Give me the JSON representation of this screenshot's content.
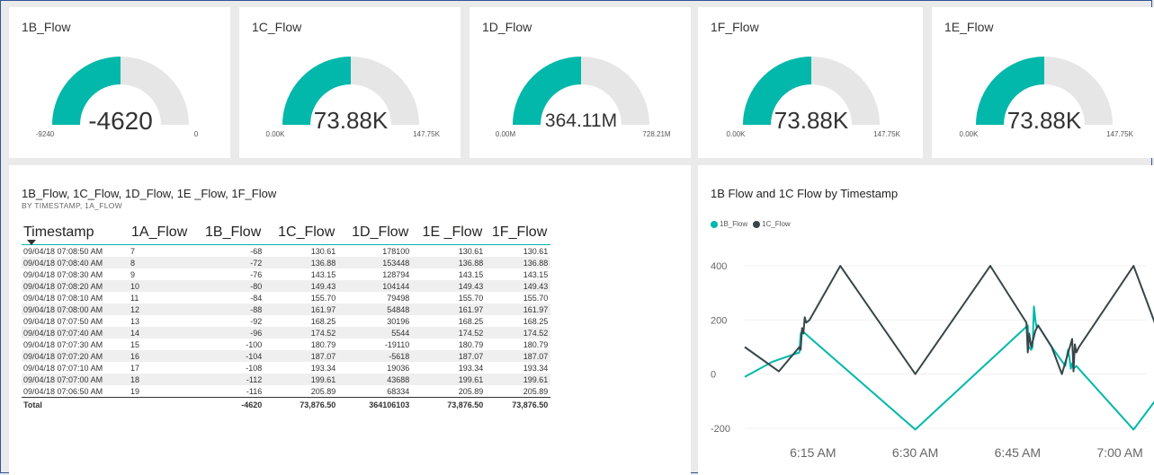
{
  "colors": {
    "accent": "#01b8aa",
    "dark": "#374649",
    "gauge_bg": "#e6e6e6"
  },
  "gauges": [
    {
      "title": "1B_Flow",
      "value": "-4620",
      "min": "-9240",
      "max": "0",
      "fraction": 0.5
    },
    {
      "title": "1C_Flow",
      "value": "73.88K",
      "min": "0.00K",
      "max": "147.75K",
      "fraction": 0.5
    },
    {
      "title": "1D_Flow",
      "value": "364.11M",
      "min": "0.00M",
      "max": "728.21M",
      "fraction": 0.5
    },
    {
      "title": "1F_Flow",
      "value": "73.88K",
      "min": "0.00K",
      "max": "147.75K",
      "fraction": 0.5
    },
    {
      "title": "1E_Flow",
      "value": "73.88K",
      "min": "0.00K",
      "max": "147.75K",
      "fraction": 0.5
    }
  ],
  "table": {
    "title": "1B_Flow, 1C_Flow, 1D_Flow, 1E _Flow, 1F_Flow",
    "subtitle": "BY TIMESTAMP, 1A_FLOW",
    "columns": [
      "Timestamp",
      "1A_Flow",
      "1B_Flow",
      "1C_Flow",
      "1D_Flow",
      "1E _Flow",
      "1F_Flow"
    ],
    "rows": [
      [
        "09/04/18 07:08:50 AM",
        "7",
        "-68",
        "130.61",
        "178100",
        "130.61",
        "130.61"
      ],
      [
        "09/04/18 07:08:40 AM",
        "8",
        "-72",
        "136.88",
        "153448",
        "136.88",
        "136.88"
      ],
      [
        "09/04/18 07:08:30 AM",
        "9",
        "-76",
        "143.15",
        "128794",
        "143.15",
        "143.15"
      ],
      [
        "09/04/18 07:08:20 AM",
        "10",
        "-80",
        "149.43",
        "104144",
        "149.43",
        "149.43"
      ],
      [
        "09/04/18 07:08:10 AM",
        "11",
        "-84",
        "155.70",
        "79498",
        "155.70",
        "155.70"
      ],
      [
        "09/04/18 07:08:00 AM",
        "12",
        "-88",
        "161.97",
        "54848",
        "161.97",
        "161.97"
      ],
      [
        "09/04/18 07:07:50 AM",
        "13",
        "-92",
        "168.25",
        "30196",
        "168.25",
        "168.25"
      ],
      [
        "09/04/18 07:07:40 AM",
        "14",
        "-96",
        "174.52",
        "5544",
        "174.52",
        "174.52"
      ],
      [
        "09/04/18 07:07:30 AM",
        "15",
        "-100",
        "180.79",
        "-19110",
        "180.79",
        "180.79"
      ],
      [
        "09/04/18 07:07:20 AM",
        "16",
        "-104",
        "187.07",
        "-5618",
        "187.07",
        "187.07"
      ],
      [
        "09/04/18 07:07:10 AM",
        "17",
        "-108",
        "193.34",
        "19036",
        "193.34",
        "193.34"
      ],
      [
        "09/04/18 07:07:00 AM",
        "18",
        "-112",
        "199.61",
        "43688",
        "199.61",
        "199.61"
      ],
      [
        "09/04/18 07:06:50 AM",
        "19",
        "-116",
        "205.89",
        "68334",
        "205.89",
        "205.89"
      ]
    ],
    "total": [
      "Total",
      "",
      "-4620",
      "73,876.50",
      "364106103",
      "73,876.50",
      "73,876.50"
    ]
  },
  "chart_data": {
    "type": "line",
    "title": "1B Flow and 1C Flow by Timestamp",
    "xlabel": "",
    "ylabel": "",
    "x_ticks": [
      "6:15 AM",
      "6:30 AM",
      "6:45 AM",
      "7:00 AM"
    ],
    "x_tick_values": [
      15,
      30,
      45,
      60
    ],
    "xlim": [
      5,
      65
    ],
    "y_ticks": [
      "400",
      "200",
      "0",
      "-200"
    ],
    "y_tick_values": [
      400,
      200,
      0,
      -200
    ],
    "ylim": [
      -240,
      440
    ],
    "legend": "top-left",
    "series": [
      {
        "name": "1B_Flow",
        "color": "#01b8aa",
        "x": [
          5,
          9,
          13,
          13.2,
          13.4,
          30,
          46.5,
          46.6,
          47,
          47.2,
          47.4,
          47.6,
          47.8,
          48,
          50,
          52,
          52.4,
          52.6,
          52.8,
          53,
          53.2,
          53.6,
          62,
          66
        ],
        "y": [
          -10,
          45,
          80,
          150,
          160,
          -205,
          180,
          100,
          90,
          100,
          250,
          200,
          170,
          180,
          100,
          30,
          90,
          60,
          20,
          40,
          20,
          30,
          -205,
          -70
        ]
      },
      {
        "name": "1C_Flow",
        "color": "#374649",
        "x": [
          5,
          10,
          13,
          13.2,
          13.4,
          13.6,
          13.8,
          14,
          14.5,
          19,
          30,
          41,
          46.3,
          46.5,
          46.7,
          47,
          47.3,
          47.6,
          48,
          50,
          51.5,
          53,
          53.2,
          53.4,
          53.6,
          54,
          62,
          66
        ],
        "y": [
          100,
          10,
          100,
          90,
          170,
          150,
          210,
          190,
          200,
          400,
          0,
          400,
          190,
          80,
          150,
          100,
          130,
          160,
          180,
          100,
          0,
          130,
          10,
          110,
          80,
          100,
          400,
          130
        ]
      }
    ]
  }
}
